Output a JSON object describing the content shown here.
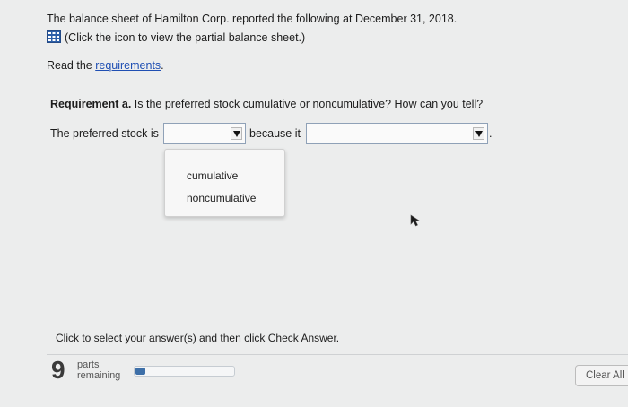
{
  "problem": {
    "statement": "The balance sheet of Hamilton Corp. reported the following at December 31, 2018.",
    "icon_link_text": "(Click the icon to view the partial balance sheet.)",
    "read_prefix": "Read the ",
    "requirements_link": "requirements",
    "read_suffix": "."
  },
  "requirement": {
    "label": "Requirement a.",
    "question": " Is the preferred stock cumulative or noncumulative? How can you tell?"
  },
  "answer": {
    "prefix": "The preferred stock is",
    "middle": "because it",
    "end": ".",
    "select1_value": "",
    "select2_value": ""
  },
  "dropdown": {
    "options": [
      "cumulative",
      "noncumulative"
    ]
  },
  "footer": {
    "instruction": "Click to select your answer(s) and then click Check Answer.",
    "parts_count": "9",
    "parts_line1": "parts",
    "parts_line2": "remaining",
    "progress_fraction": 0.1,
    "clear_all_label": "Clear All"
  },
  "colors": {
    "link": "#1f4fb3",
    "progress": "#3d6fa8",
    "background": "#eceded"
  },
  "icons": {
    "balance_sheet": "calculator-grid-icon",
    "cursor": "mouse-pointer-icon"
  }
}
